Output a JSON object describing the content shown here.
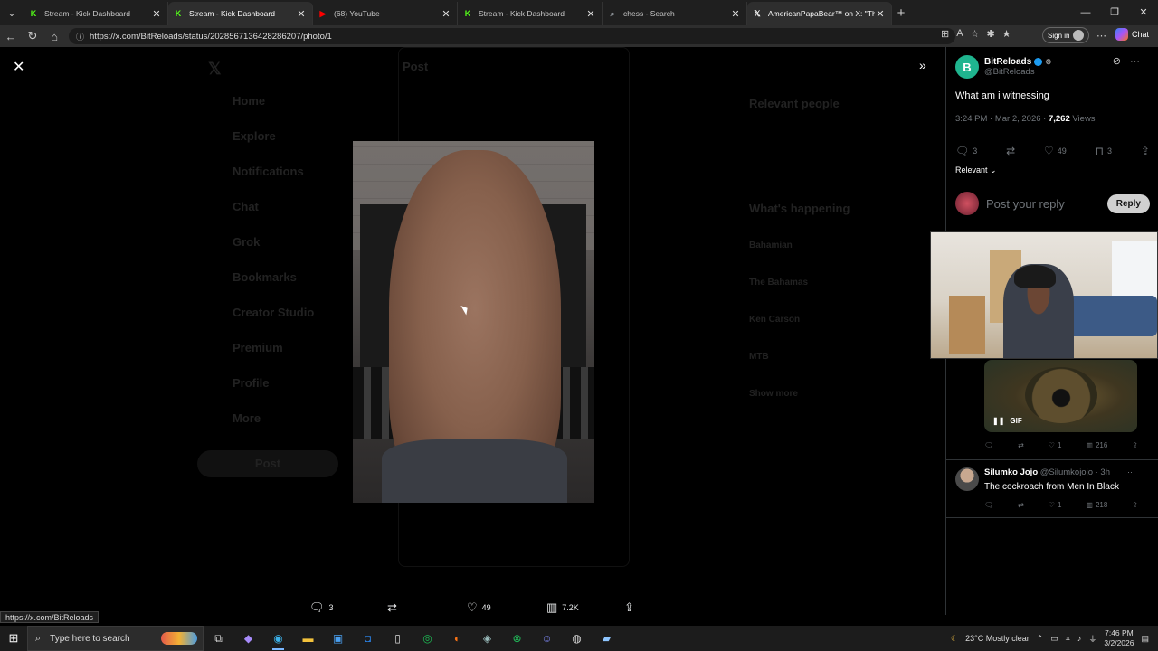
{
  "browser": {
    "tabs": [
      {
        "title": "Stream - Kick Dashboard",
        "icon": "kick-icon",
        "color": "#53fc18"
      },
      {
        "title": "Stream - Kick Dashboard",
        "icon": "kick-icon",
        "color": "#53fc18"
      },
      {
        "title": "(68) YouTube",
        "icon": "youtube-icon",
        "color": "#ff0000"
      },
      {
        "title": "Stream - Kick Dashboard",
        "icon": "kick-icon",
        "color": "#53fc18"
      },
      {
        "title": "chess - Search",
        "icon": "search-icon",
        "color": "#9aa0a6"
      },
      {
        "title": "AmericanPapaBear™ on X: \"The tr...",
        "icon": "x-icon",
        "color": "#ffffff"
      }
    ],
    "url": "https://x.com/BitReloads/status/2028567136428286207/photo/1",
    "sign_in": "Sign in",
    "chat": "Chat"
  },
  "background_nav": [
    "Home",
    "Explore",
    "Notifications",
    "Chat",
    "Grok",
    "Bookmarks",
    "Creator Studio",
    "Premium",
    "Profile",
    "More"
  ],
  "background_post_button": "Post",
  "background_header": "Post",
  "background_right": {
    "relevant": "Relevant people",
    "happening": "What's happening",
    "trends": [
      "Bahamian",
      "The Bahamas",
      "Ken Carson",
      "MTB",
      "Show more"
    ]
  },
  "media_actions": {
    "replies": "3",
    "reposts": "",
    "likes": "49",
    "views": "7.2K"
  },
  "tweet": {
    "avatar_letter": "B",
    "name": "BitReloads",
    "handle": "@BitReloads",
    "text": "What am i witnessing",
    "time": "3:24 PM · Mar 2, 2026 · ",
    "views_count": "7,262",
    "views_label": " Views",
    "replies": "3",
    "likes": "49",
    "bookmarks": "3",
    "sort": "Relevant",
    "reply_placeholder": "Post your reply",
    "reply_button": "Reply"
  },
  "gif_reply": {
    "badge": "GIF",
    "likes": "1",
    "views": "216"
  },
  "reply2": {
    "name": "Silumko Jojo",
    "handle": "@Silumkojojo · 3h",
    "text": "The cockroach from Men In Black",
    "likes": "1",
    "views": "218"
  },
  "status_url": "https://x.com/BitReloads",
  "taskbar": {
    "search_placeholder": "Type here to search",
    "weather": "23°C  Mostly clear",
    "time": "7:46 PM",
    "date": "3/2/2026"
  }
}
